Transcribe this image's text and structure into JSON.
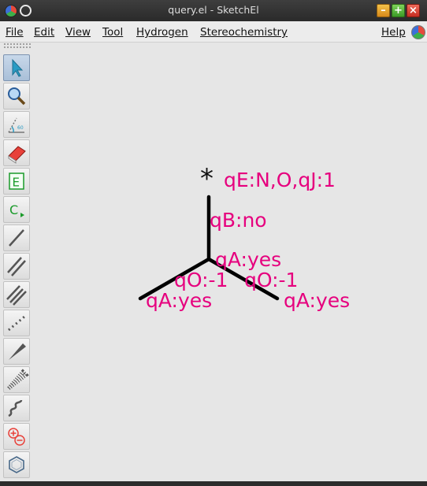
{
  "window": {
    "title": "query.el - SketchEl"
  },
  "menu": {
    "file": "File",
    "edit": "Edit",
    "view": "View",
    "tool": "Tool",
    "hydrogen": "Hydrogen",
    "stereochemistry": "Stereochemistry",
    "help": "Help"
  },
  "toolbar": {
    "tools": [
      "select-arrow-icon",
      "zoom-icon",
      "rotate-icon",
      "eraser-icon",
      "element-icon",
      "charge-icon",
      "single-bond-icon",
      "double-bond-icon",
      "triple-bond-icon",
      "zero-bond-icon",
      "wedge-bond-icon",
      "hashed-bond-icon",
      "wavy-bond-icon",
      "charge-plus-minus-icon",
      "ring-icon"
    ],
    "element_label": "E",
    "charge_label": "C"
  },
  "molecule": {
    "atom_symbol": "*",
    "atom_query": "qE:N,O,qJ:1",
    "bond_top": "qB:no",
    "center_query": "qA:yes",
    "left_bond": "qO:-1",
    "right_bond": "qO:-1",
    "left_atom": "qA:yes",
    "right_atom": "qA:yes"
  },
  "colors": {
    "query_label": "#e6007e",
    "bond": "#000000"
  }
}
